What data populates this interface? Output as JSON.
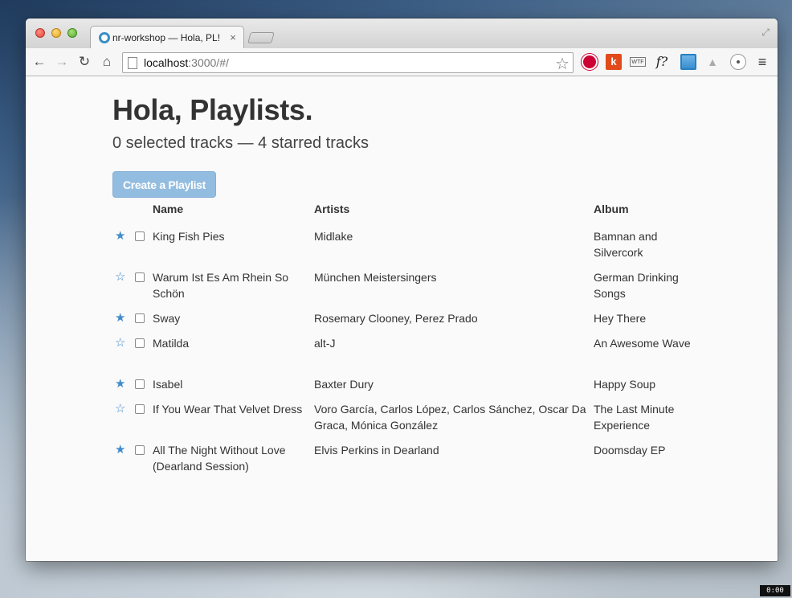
{
  "browser": {
    "tab_title": "nr-workshop — Hola, PL!",
    "tab_close": "×",
    "url_host": "localhost",
    "url_rest": ":3000/#/"
  },
  "toolbar_icons": {
    "back": "←",
    "forward": "→",
    "reload": "↻",
    "home": "⌂",
    "bookmark": "☆",
    "menu": "≡",
    "ext_k": "k",
    "ext_wtf": "WTF",
    "ext_font": "f?"
  },
  "page": {
    "heading": "Hola, Playlists.",
    "subheading": "0 selected tracks — 4 starred tracks",
    "create_button": "Create a Playlist"
  },
  "table": {
    "headers": {
      "name": "Name",
      "artists": "Artists",
      "album": "Album"
    },
    "rows": [
      {
        "starred": true,
        "star": "★",
        "name": "King Fish Pies",
        "artists": "Midlake",
        "album": "Bamnan and Silvercork"
      },
      {
        "starred": false,
        "star": "☆",
        "name": "Warum Ist Es Am Rhein So Schön",
        "artists": "München Meistersingers",
        "album": "German Drinking Songs"
      },
      {
        "starred": true,
        "star": "★",
        "name": "Sway",
        "artists": "Rosemary Clooney, Perez Prado",
        "album": "Hey There"
      },
      {
        "starred": false,
        "star": "☆",
        "name": "Matilda",
        "artists": "alt-J",
        "album": "An Awesome Wave"
      },
      {
        "starred": true,
        "star": "★",
        "name": "Isabel",
        "artists": "Baxter Dury",
        "album": "Happy Soup"
      },
      {
        "starred": false,
        "star": "☆",
        "name": "If You Wear That Velvet Dress",
        "artists": "Voro García, Carlos López, Carlos Sánchez, Oscar Da Graca, Mónica González",
        "album": "The Last Minute Experience"
      },
      {
        "starred": true,
        "star": "★",
        "name": "All The Night Without Love (Dearland Session)",
        "artists": "Elvis Perkins in Dearland",
        "album": "Doomsday EP"
      }
    ]
  },
  "overlay": {
    "timer": "0:00"
  },
  "colors": {
    "accent": "#428bca",
    "button_bg": "#93bde0",
    "text": "#333333"
  }
}
